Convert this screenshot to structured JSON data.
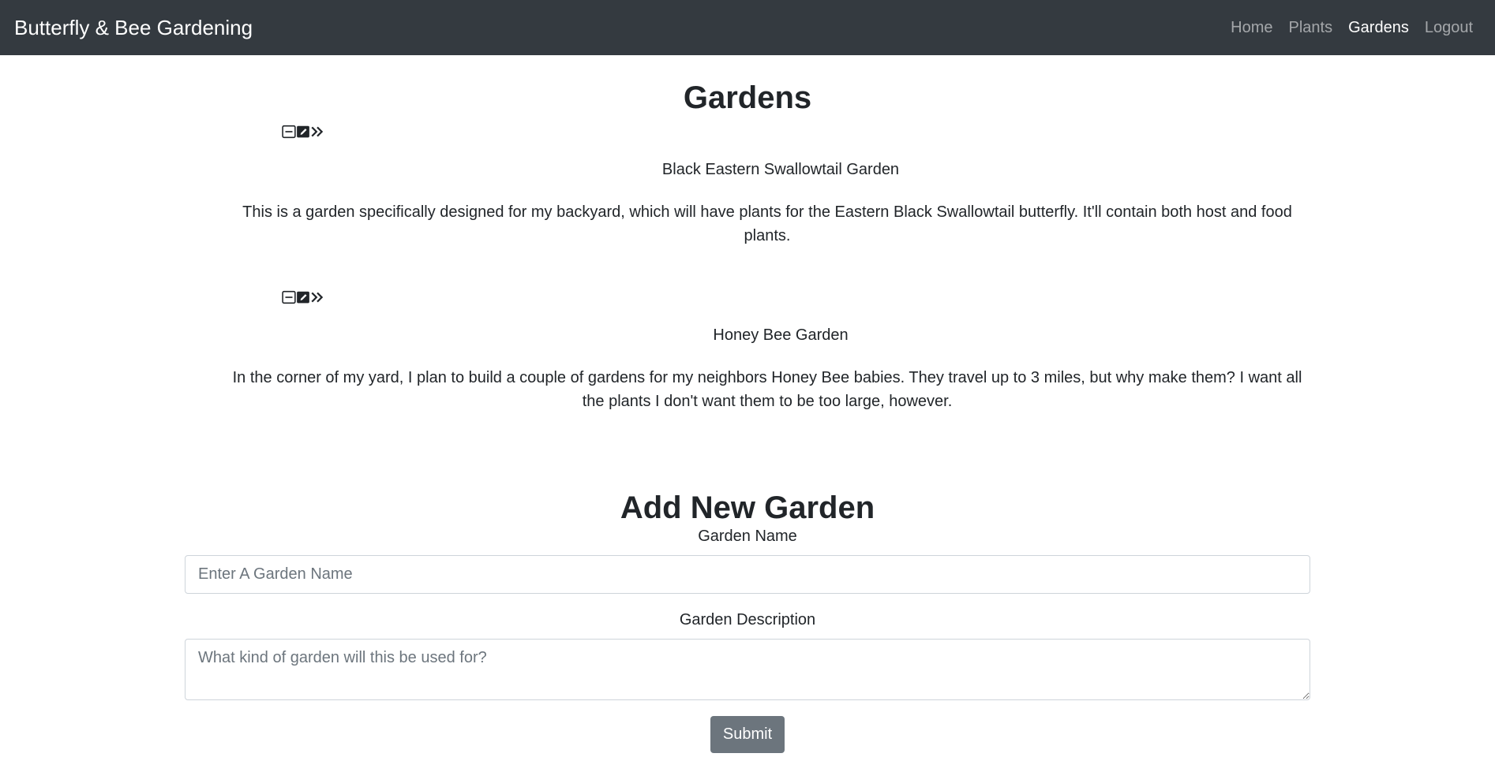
{
  "app": {
    "brand": "Butterfly & Bee Gardening",
    "nav": [
      {
        "label": "Home",
        "active": false
      },
      {
        "label": "Plants",
        "active": false
      },
      {
        "label": "Gardens",
        "active": true
      },
      {
        "label": "Logout",
        "active": false
      }
    ]
  },
  "page": {
    "title": "Gardens"
  },
  "gardens": [
    {
      "name": "Black Eastern Swallowtail Garden",
      "description": "This is a garden specifically designed for my backyard, which will have plants for the Eastern Black Swallowtail butterfly. It'll contain both host and food plants.",
      "actions": [
        "minus-square-icon",
        "pencil-square-icon",
        "chevron-double-right-icon"
      ]
    },
    {
      "name": "Honey Bee Garden",
      "description": "In the corner of my yard, I plan to build a couple of gardens for my neighbors Honey Bee babies. They travel up to 3 miles, but why make them? I want all the plants I don't want them to be too large, however.",
      "actions": [
        "minus-square-icon",
        "pencil-square-icon",
        "chevron-double-right-icon"
      ]
    }
  ],
  "form": {
    "title": "Add New Garden",
    "name_label": "Garden Name",
    "name_placeholder": "Enter A Garden Name",
    "desc_label": "Garden Description",
    "desc_placeholder": "What kind of garden will this be used for?",
    "submit_label": "Submit"
  },
  "colors": {
    "navbar": "#343a40",
    "submit": "#6c757d"
  }
}
